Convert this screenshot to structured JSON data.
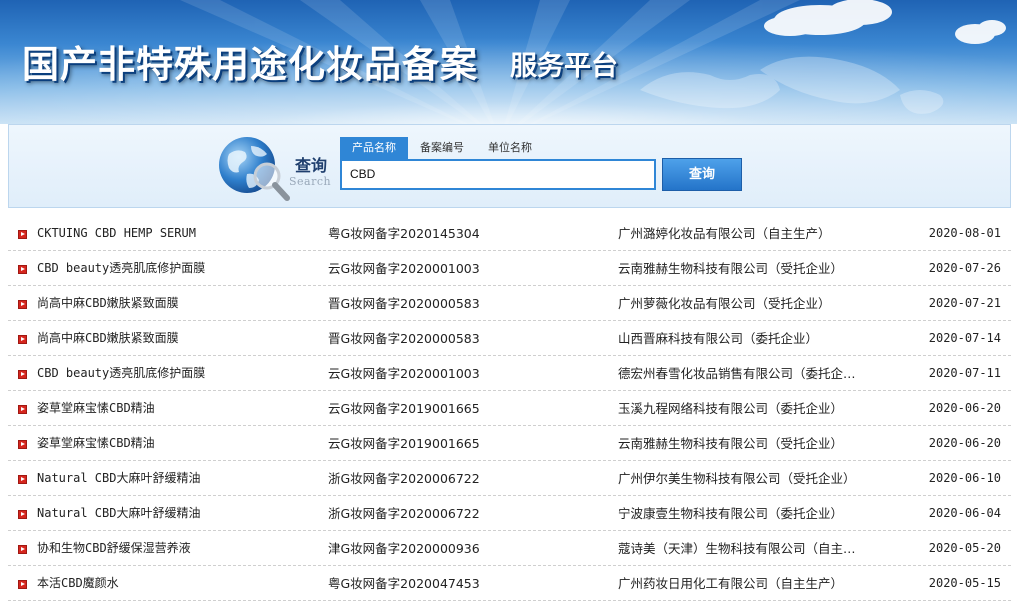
{
  "banner": {
    "title": "国产非特殊用途化妆品备案",
    "subtitle": "服务平台"
  },
  "search": {
    "label_cn": "查询",
    "label_en": "Search",
    "tabs": [
      {
        "label": "产品名称",
        "active": true
      },
      {
        "label": "备案编号",
        "active": false
      },
      {
        "label": "单位名称",
        "active": false
      }
    ],
    "input_value": "CBD",
    "button_label": "查询"
  },
  "colors": {
    "accent": "#2f86d6",
    "bullet": "#d6261e",
    "panel_bg": "#e6f1fb"
  },
  "results": [
    {
      "product": "CKTUING CBD HEMP SERUM",
      "record": "粤G妆网备字2020145304",
      "company": "广州潞婷化妆品有限公司（自主生产）",
      "date": "2020-08-01"
    },
    {
      "product": "CBD beauty透亮肌底修护面膜",
      "record": "云G妆网备字2020001003",
      "company": "云南雅赫生物科技有限公司（受托企业）",
      "date": "2020-07-26"
    },
    {
      "product": "尚高中麻CBD嫩肤紧致面膜",
      "record": "晋G妆网备字2020000583",
      "company": "广州萝薇化妆品有限公司（受托企业）",
      "date": "2020-07-21"
    },
    {
      "product": "尚高中麻CBD嫩肤紧致面膜",
      "record": "晋G妆网备字2020000583",
      "company": "山西晋麻科技有限公司（委托企业）",
      "date": "2020-07-14"
    },
    {
      "product": "CBD beauty透亮肌底修护面膜",
      "record": "云G妆网备字2020001003",
      "company": "德宏州春雪化妆品销售有限公司（委托企…",
      "date": "2020-07-11"
    },
    {
      "product": "姿草堂麻宝愫CBD精油",
      "record": "云G妆网备字2019001665",
      "company": "玉溪九程网络科技有限公司（委托企业）",
      "date": "2020-06-20"
    },
    {
      "product": "姿草堂麻宝愫CBD精油",
      "record": "云G妆网备字2019001665",
      "company": "云南雅赫生物科技有限公司（受托企业）",
      "date": "2020-06-20"
    },
    {
      "product": "Natural CBD大麻叶舒缓精油",
      "record": "浙G妆网备字2020006722",
      "company": "广州伊尔美生物科技有限公司（受托企业）",
      "date": "2020-06-10"
    },
    {
      "product": "Natural CBD大麻叶舒缓精油",
      "record": "浙G妆网备字2020006722",
      "company": "宁波康壹生物科技有限公司（委托企业）",
      "date": "2020-06-04"
    },
    {
      "product": "协和生物CBD舒缓保湿营养液",
      "record": "津G妆网备字2020000936",
      "company": "蔻诗美（天津）生物科技有限公司（自主…",
      "date": "2020-05-20"
    },
    {
      "product": "本活CBD魔颜水",
      "record": "粤G妆网备字2020047453",
      "company": "广州药妆日用化工有限公司（自主生产）",
      "date": "2020-05-15"
    }
  ]
}
